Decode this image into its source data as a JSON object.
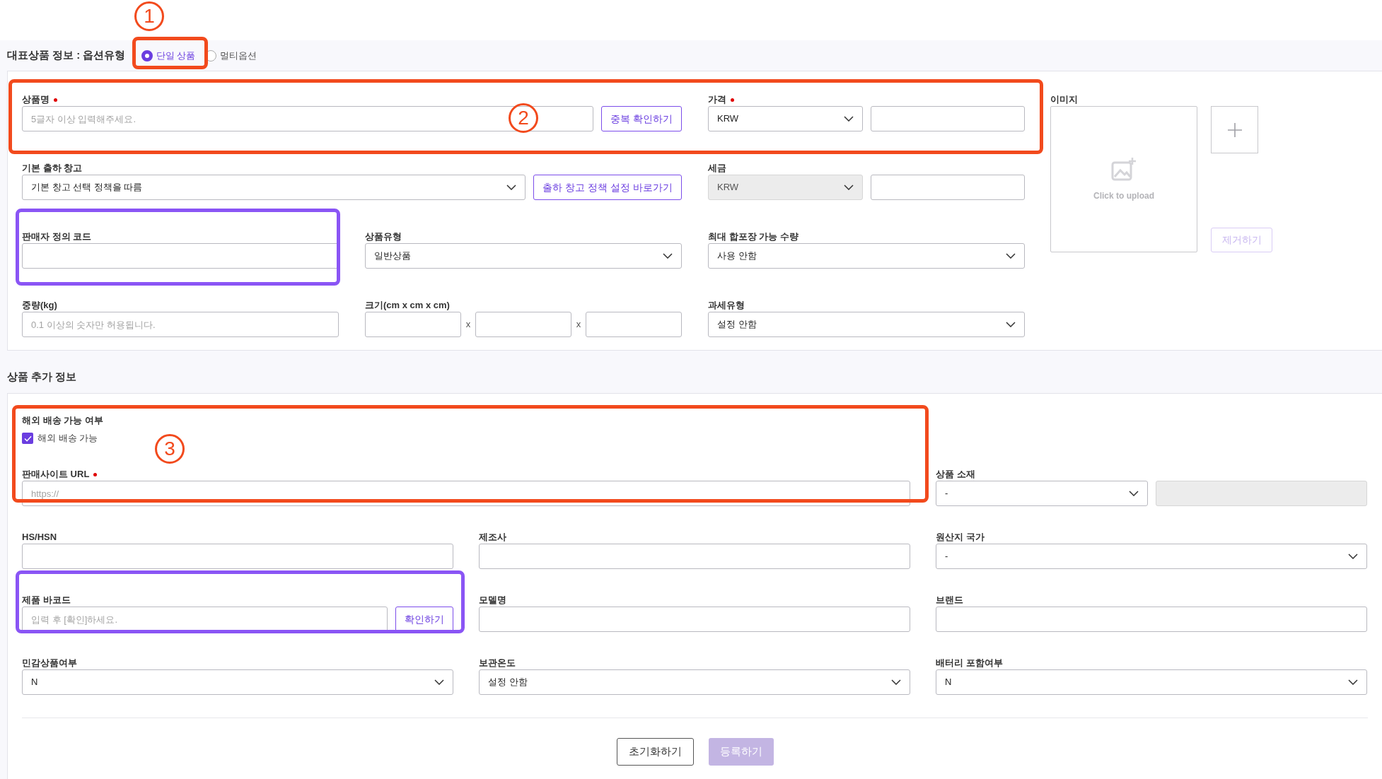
{
  "header": {
    "title": "대표상품 정보 : 옵션유형",
    "option_types": [
      {
        "label": "단일 상품",
        "selected": true
      },
      {
        "label": "멀티옵션",
        "selected": false
      }
    ]
  },
  "basic_fields": [
    {
      "label": "상품명",
      "required": true,
      "controls": [
        {
          "kind": "input",
          "placeholder": "5글자 이상 입력해주세요.",
          "disabled": false
        },
        {
          "kind": "button",
          "label": "중복 확인하기",
          "disabled": false
        }
      ]
    },
    {
      "label": "가격",
      "required": true,
      "controls": [
        {
          "kind": "select",
          "value": "KRW",
          "disabled": false
        },
        {
          "kind": "input",
          "disabled": false
        }
      ]
    },
    {
      "label": "기본 출하 창고",
      "required": false,
      "controls": [
        {
          "kind": "select",
          "value": "기본 창고 선택 정책을 따름",
          "disabled": false
        },
        {
          "kind": "button",
          "label": "출하 창고 정책 설정 바로가기",
          "disabled": false
        }
      ]
    },
    {
      "label": "세금",
      "required": false,
      "controls": [
        {
          "kind": "select",
          "value": "KRW",
          "disabled": true
        },
        {
          "kind": "input",
          "disabled": false
        }
      ]
    },
    {
      "label": "판매자 정의 코드",
      "required": false,
      "controls": [
        {
          "kind": "input",
          "disabled": false
        }
      ]
    },
    {
      "label": "상품유형",
      "required": false,
      "controls": [
        {
          "kind": "select",
          "value": "일반상품",
          "disabled": false
        }
      ]
    },
    {
      "label": "최대 합포장 가능 수량",
      "required": false,
      "controls": [
        {
          "kind": "select",
          "value": "사용 안함",
          "disabled": false
        }
      ]
    },
    {
      "label": "중량(kg)",
      "required": false,
      "controls": [
        {
          "kind": "input",
          "placeholder": "0.1 이상의 숫자만 허용됩니다.",
          "disabled": false
        }
      ]
    },
    {
      "label": "크기(cm x cm x cm)",
      "required": false,
      "controls": [
        {
          "kind": "input",
          "disabled": false
        },
        {
          "kind": "separator",
          "text": "x"
        },
        {
          "kind": "input",
          "disabled": false
        },
        {
          "kind": "separator",
          "text": "x"
        },
        {
          "kind": "input",
          "disabled": false
        }
      ]
    },
    {
      "label": "과세유형",
      "required": false,
      "controls": [
        {
          "kind": "select",
          "value": "설정 안함",
          "disabled": false
        }
      ]
    }
  ],
  "image": {
    "label": "이미지",
    "upload_text": "Click to upload",
    "remove_button": {
      "label": "제거하기",
      "disabled": true
    }
  },
  "additional_title": "상품 추가 정보",
  "additional_fields": [
    {
      "label": "해외 배송 가능 여부",
      "required": false,
      "controls": [
        {
          "kind": "checkbox",
          "label": "해외 배송 가능",
          "checked": true
        }
      ]
    },
    {
      "label": "판매사이트 URL",
      "required": true,
      "controls": [
        {
          "kind": "input",
          "placeholder": "https://",
          "disabled": false
        }
      ]
    },
    {
      "label": "상품 소재",
      "required": false,
      "controls": [
        {
          "kind": "select",
          "value": "-",
          "disabled": false
        },
        {
          "kind": "input",
          "disabled": true
        }
      ]
    },
    {
      "label": "HS/HSN",
      "required": false,
      "controls": [
        {
          "kind": "input",
          "disabled": false
        }
      ]
    },
    {
      "label": "제조사",
      "required": false,
      "controls": [
        {
          "kind": "input",
          "disabled": false
        }
      ]
    },
    {
      "label": "원산지 국가",
      "required": false,
      "controls": [
        {
          "kind": "select",
          "value": "-",
          "disabled": false
        }
      ]
    },
    {
      "label": "제품 바코드",
      "required": false,
      "controls": [
        {
          "kind": "input",
          "placeholder": "입력 후 [확인]하세요.",
          "disabled": false
        },
        {
          "kind": "button",
          "label": "확인하기",
          "disabled": false
        }
      ]
    },
    {
      "label": "모델명",
      "required": false,
      "controls": [
        {
          "kind": "input",
          "disabled": false
        }
      ]
    },
    {
      "label": "브랜드",
      "required": false,
      "controls": [
        {
          "kind": "input",
          "disabled": false
        }
      ]
    },
    {
      "label": "민감상품여부",
      "required": false,
      "controls": [
        {
          "kind": "select",
          "value": "N",
          "disabled": false
        }
      ]
    },
    {
      "label": "보관온도",
      "required": false,
      "controls": [
        {
          "kind": "select",
          "value": "설정 안함",
          "disabled": false
        }
      ]
    },
    {
      "label": "배터리 포함여부",
      "required": false,
      "controls": [
        {
          "kind": "select",
          "value": "N",
          "disabled": false
        }
      ]
    }
  ],
  "footer_buttons": [
    {
      "label": "초기화하기",
      "disabled": false
    },
    {
      "label": "등록하기",
      "disabled": true
    }
  ],
  "step_markers": [
    "1",
    "2",
    "3"
  ],
  "highlights": [
    {
      "color": "#f24a1d"
    },
    {
      "color": "#f24a1d"
    },
    {
      "color": "#8a55f5"
    },
    {
      "color": "#f24a1d"
    },
    {
      "color": "#8a55f5"
    }
  ]
}
